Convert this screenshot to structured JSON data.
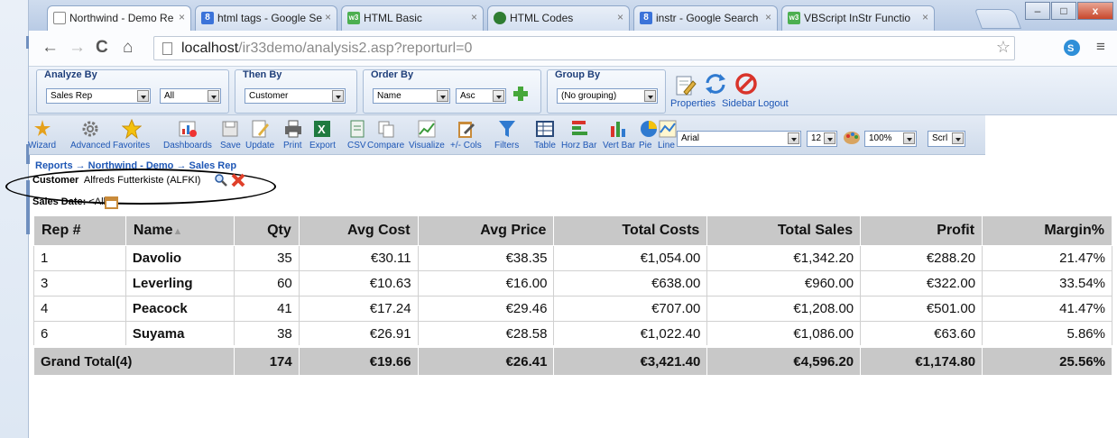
{
  "browser": {
    "tabs": [
      {
        "label": "Northwind - Demo Re",
        "icon": "page-icon",
        "active": true
      },
      {
        "label": "html tags - Google Se",
        "icon": "google-icon"
      },
      {
        "label": "HTML Basic",
        "icon": "w3schools-icon"
      },
      {
        "label": "HTML Codes",
        "icon": "globe-icon"
      },
      {
        "label": "instr - Google Search",
        "icon": "google-icon"
      },
      {
        "label": "VBScript InStr Functio",
        "icon": "w3schools-icon"
      }
    ],
    "url_host": "localhost",
    "url_path": "/ir33demo/analysis2.asp?reporturl=0"
  },
  "toolbar": {
    "analyze_by": {
      "title": "Analyze By",
      "value": "Sales Rep",
      "filter": "All"
    },
    "then_by": {
      "title": "Then By",
      "value": "Customer"
    },
    "order_by": {
      "title": "Order By",
      "value": "Name",
      "direction": "Asc"
    },
    "group_by": {
      "title": "Group By",
      "value": "(No grouping)"
    },
    "properties": "Properties",
    "sidebar": "Sidebar",
    "logout": "Logout"
  },
  "iconbar": {
    "buttons": [
      "Wizard",
      "Advanced",
      "Favorites",
      "Dashboards",
      "Save",
      "Update",
      "Print",
      "Export",
      "CSV",
      "Compare",
      "Visualize",
      "+/- Cols",
      "Filters",
      "Table",
      "Horz Bar",
      "Vert Bar",
      "Pie",
      "Line"
    ],
    "font": "Arial",
    "font_size": "12",
    "zoom": "100%",
    "scroll": "Scrl"
  },
  "breadcrumb": "Reports → Northwind - Demo → Sales Rep",
  "filter": {
    "label": "Customer",
    "value": "Alfreds Futterkiste (ALFKI)",
    "sales_date_label": "Sales Date:",
    "sales_date_value": "<All>"
  },
  "table": {
    "headers": [
      "Rep #",
      "Name",
      "Qty",
      "Avg Cost",
      "Avg Price",
      "Total Costs",
      "Total Sales",
      "Profit",
      "Margin%"
    ],
    "rows": [
      [
        "1",
        "Davolio",
        "35",
        "€30.11",
        "€38.35",
        "€1,054.00",
        "€1,342.20",
        "€288.20",
        "21.47%"
      ],
      [
        "3",
        "Leverling",
        "60",
        "€10.63",
        "€16.00",
        "€638.00",
        "€960.00",
        "€322.00",
        "33.54%"
      ],
      [
        "4",
        "Peacock",
        "41",
        "€17.24",
        "€29.46",
        "€707.00",
        "€1,208.00",
        "€501.00",
        "41.47%"
      ],
      [
        "6",
        "Suyama",
        "38",
        "€26.91",
        "€28.58",
        "€1,022.40",
        "€1,086.00",
        "€63.60",
        "5.86%"
      ]
    ],
    "total": [
      "Grand Total(4)",
      "174",
      "€19.66",
      "€26.41",
      "€3,421.40",
      "€4,596.20",
      "€1,174.80",
      "25.56%"
    ]
  }
}
